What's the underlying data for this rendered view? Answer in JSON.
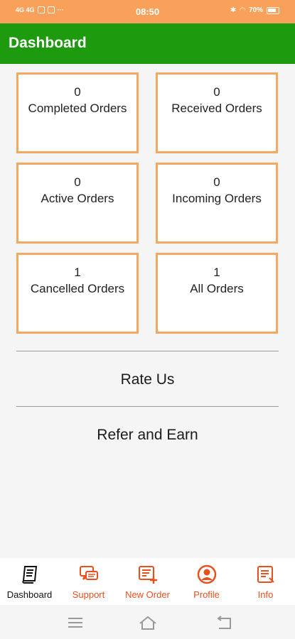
{
  "status_bar": {
    "time": "08:50",
    "battery": "70%",
    "left_text": "4G 4G",
    "more": "···"
  },
  "app_bar": {
    "title": "Dashboard"
  },
  "tiles": [
    {
      "count": "0",
      "label": "Completed Orders"
    },
    {
      "count": "0",
      "label": "Received Orders"
    },
    {
      "count": "0",
      "label": "Active Orders"
    },
    {
      "count": "0",
      "label": "Incoming Orders"
    },
    {
      "count": "1",
      "label": "Cancelled Orders"
    },
    {
      "count": "1",
      "label": "All Orders"
    }
  ],
  "links": {
    "rate_us": "Rate Us",
    "refer_and_earn": "Refer and Earn"
  },
  "bottom_nav": {
    "items": [
      {
        "label": "Dashboard",
        "icon": "dashboard-icon"
      },
      {
        "label": "Support",
        "icon": "support-chat-icon"
      },
      {
        "label": "New Order",
        "icon": "new-order-icon"
      },
      {
        "label": "Profile",
        "icon": "profile-icon"
      },
      {
        "label": "Info",
        "icon": "info-document-icon"
      }
    ]
  },
  "colors": {
    "status_bar": "#f9a15a",
    "app_bar": "#1e9a0f",
    "tile_border": "#f4a860",
    "nav_accent": "#e8501e"
  }
}
